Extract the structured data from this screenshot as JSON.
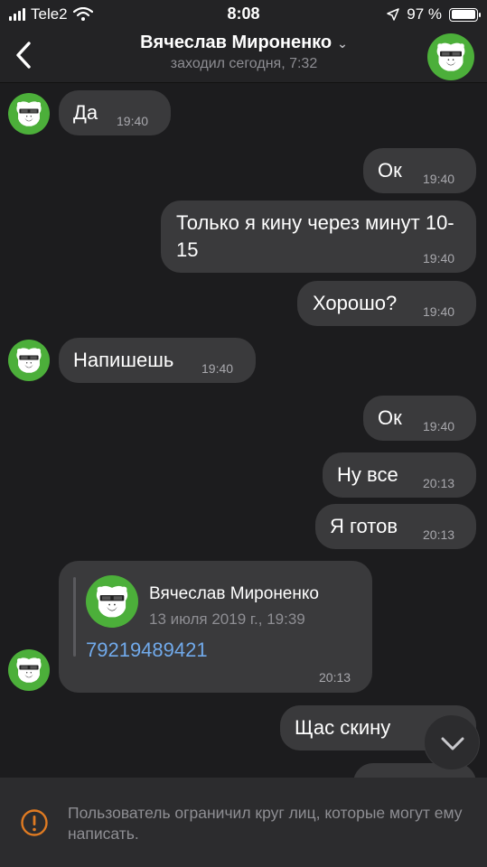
{
  "status_bar": {
    "carrier": "Tele2",
    "time": "8:08",
    "battery": "97 %"
  },
  "header": {
    "title": "Вячеслав Мироненко",
    "subtitle": "заходил сегодня, 7:32"
  },
  "messages": [
    {
      "text": "Да",
      "time": "19:40",
      "side": "in"
    },
    {
      "text": "Ок",
      "time": "19:40",
      "side": "out"
    },
    {
      "text": "Только я кину через минут 10-15",
      "time": "19:40",
      "side": "out"
    },
    {
      "text": "Хорошо?",
      "time": "19:40",
      "side": "out"
    },
    {
      "text": "Напишешь",
      "time": "19:40",
      "side": "in"
    },
    {
      "text": "Ок",
      "time": "19:40",
      "side": "out"
    },
    {
      "text": "Ну все",
      "time": "20:13",
      "side": "out"
    },
    {
      "text": "Я готов",
      "time": "20:13",
      "side": "out"
    },
    {
      "text": "Щас скину",
      "time": "",
      "side": "out"
    }
  ],
  "forwarded": {
    "name": "Вячеслав Мироненко",
    "date": "13 июля 2019 г., 19:39",
    "phone": "79219489421",
    "time": "20:13"
  },
  "notice": {
    "text": "Пользователь ограничил круг лиц, которые могут ему написать."
  },
  "colors": {
    "avatar_green": "#4caf3a",
    "link_blue": "#71aaeb",
    "warning_orange": "#e07b22"
  }
}
